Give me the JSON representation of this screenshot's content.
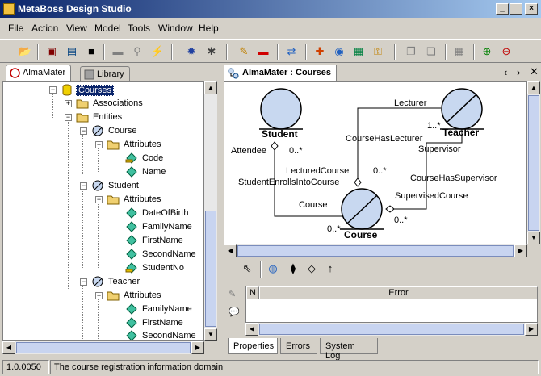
{
  "window": {
    "title": "MetaBoss Design Studio"
  },
  "menu": [
    "File",
    "Action",
    "View",
    "Model",
    "Tools",
    "Window",
    "Help"
  ],
  "left_tabs": [
    {
      "label": "AlmaMater"
    },
    {
      "label": "Library"
    }
  ],
  "tree": {
    "courses": "Courses",
    "associations": "Associations",
    "entities": "Entities",
    "course": "Course",
    "attributes": "Attributes",
    "code": "Code",
    "name": "Name",
    "student": "Student",
    "date_of_birth": "DateOfBirth",
    "family_name": "FamilyName",
    "first_name": "FirstName",
    "second_name": "SecondName",
    "student_no": "StudentNo",
    "teacher": "Teacher"
  },
  "document_tab": {
    "label": "AlmaMater : Courses"
  },
  "diagram": {
    "student": "Student",
    "teacher": "Teacher",
    "course": "Course",
    "lecturer": "Lecturer",
    "course_has_lecturer": "CourseHasLecturer",
    "mult_1_n": "1..*",
    "supervisor": "Supervisor",
    "attendee": "Attendee",
    "mult_0_n_a": "0..*",
    "lectured_course": "LecturedCourse",
    "mult_0_n_b": "0..*",
    "course_has_supervisor": "CourseHasSupervisor",
    "student_enrolls": "StudentEnrollsIntoCourse",
    "course_role": "Course",
    "supervised_course": "SupervisedCourse",
    "mult_0_n_c": "0..*",
    "mult_0_n_d": "0..*"
  },
  "errors_table": {
    "col_n": "N",
    "col_error": "Error"
  },
  "bottom_tabs": [
    "Properties",
    "Errors",
    "System Log"
  ],
  "status": {
    "version": "1.0.0050",
    "message": "The course registration information domain"
  }
}
